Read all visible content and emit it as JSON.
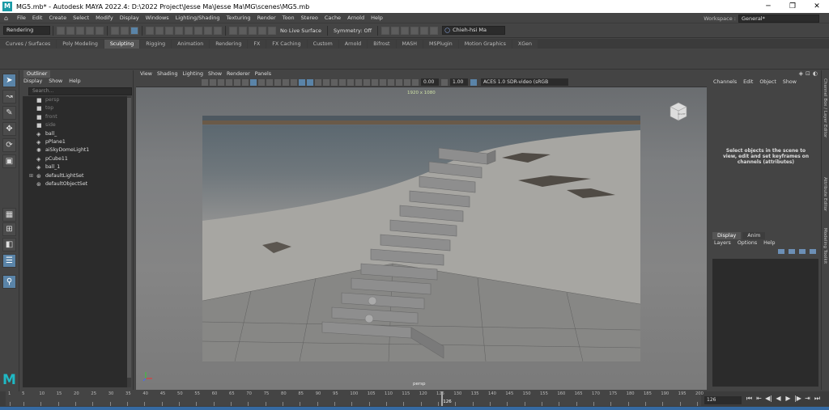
{
  "window": {
    "title": "MG5.mb* - Autodesk MAYA 2022.4: D:\\2022 Project\\Jesse Ma\\Jesse Ma\\MG\\scenes\\MG5.mb",
    "app_icon": "M",
    "minimize": "─",
    "maximize": "❐",
    "close": "✕"
  },
  "menu": {
    "items": [
      "File",
      "Edit",
      "Create",
      "Select",
      "Modify",
      "Display",
      "Windows",
      "Lighting/Shading",
      "Texturing",
      "Render",
      "Toon",
      "Stereo",
      "Cache",
      "Arnold",
      "Help"
    ],
    "workspace_label": "Workspace :",
    "workspace_value": "General*"
  },
  "status_line": {
    "mode": "Rendering",
    "live_surface": "No Live Surface",
    "symmetry": "Symmetry: Off",
    "user": "Chieh-hsi Ma"
  },
  "shelf": {
    "tabs": [
      "Curves / Surfaces",
      "Poly Modeling",
      "Sculpting",
      "Rigging",
      "Animation",
      "Rendering",
      "FX",
      "FX Caching",
      "Custom",
      "Arnold",
      "Bifrost",
      "MASH",
      "MSPlugin",
      "Motion Graphics",
      "XGen"
    ],
    "active_tab": "Sculpting"
  },
  "toolbox": {
    "tools": [
      {
        "name": "select-tool-icon",
        "glyph": "➤",
        "on": true
      },
      {
        "name": "lasso-tool-icon",
        "glyph": "↝",
        "on": false
      },
      {
        "name": "paint-select-tool-icon",
        "glyph": "✎",
        "on": false
      },
      {
        "name": "move-tool-icon",
        "glyph": "✥",
        "on": false
      },
      {
        "name": "rotate-tool-icon",
        "glyph": "⟳",
        "on": false
      },
      {
        "name": "scale-tool-icon",
        "glyph": "▣",
        "on": false
      },
      {
        "name": "single-perspective-icon",
        "glyph": "▦",
        "on": false
      },
      {
        "name": "four-view-icon",
        "glyph": "⊞",
        "on": false
      },
      {
        "name": "two-view-icon",
        "glyph": "◧",
        "on": false
      },
      {
        "name": "outliner-layout-icon",
        "glyph": "☰",
        "on": true
      },
      {
        "name": "search-tool-icon",
        "glyph": "⚲",
        "on": true
      }
    ],
    "logo": "M"
  },
  "outliner": {
    "tab": "Outliner",
    "menu": [
      "Display",
      "Show",
      "Help"
    ],
    "search_placeholder": "Search...",
    "items": [
      {
        "label": "persp",
        "icon": "camera-icon",
        "glyph": "■",
        "dim": true,
        "expand": ""
      },
      {
        "label": "top",
        "icon": "camera-icon",
        "glyph": "■",
        "dim": true,
        "expand": ""
      },
      {
        "label": "front",
        "icon": "camera-icon",
        "glyph": "■",
        "dim": true,
        "expand": ""
      },
      {
        "label": "side",
        "icon": "camera-icon",
        "glyph": "■",
        "dim": true,
        "expand": ""
      },
      {
        "label": "ball_",
        "icon": "mesh-icon",
        "glyph": "◈",
        "dim": false,
        "expand": ""
      },
      {
        "label": "pPlane1",
        "icon": "mesh-icon",
        "glyph": "◈",
        "dim": false,
        "expand": ""
      },
      {
        "label": "aiSkyDomeLight1",
        "icon": "light-icon",
        "glyph": "✺",
        "dim": false,
        "expand": ""
      },
      {
        "label": "pCube11",
        "icon": "mesh-icon",
        "glyph": "◈",
        "dim": false,
        "expand": ""
      },
      {
        "label": "ball_1",
        "icon": "mesh-icon",
        "glyph": "◈",
        "dim": false,
        "expand": ""
      },
      {
        "label": "defaultLightSet",
        "icon": "set-icon",
        "glyph": "⊛",
        "dim": false,
        "expand": "⊞"
      },
      {
        "label": "defaultObjectSet",
        "icon": "set-icon",
        "glyph": "⊛",
        "dim": false,
        "expand": ""
      }
    ]
  },
  "viewport": {
    "menu": [
      "View",
      "Shading",
      "Lighting",
      "Show",
      "Renderer",
      "Panels"
    ],
    "exposure": "0.00",
    "gamma": "1.00",
    "color_space": "ACES 1.0 SDR-video (sRGB",
    "resolution_gate": "1920 x 1080",
    "camera": "persp",
    "viewcube_label": "RIGHT"
  },
  "channel_box": {
    "menu": [
      "Channels",
      "Edit",
      "Object",
      "Show"
    ],
    "message": "Select objects in the scene to view, edit and set keyframes on channels (attributes)",
    "layer_tabs": [
      "Display",
      "Anim"
    ],
    "layer_menu": [
      "Layers",
      "Options",
      "Help"
    ],
    "side_tabs": [
      "Channel Box / Layer Editor",
      "Attribute Editor",
      "Modeling Toolkit"
    ]
  },
  "timeline": {
    "ticks": [
      "1",
      "5",
      "10",
      "15",
      "20",
      "25",
      "30",
      "35",
      "40",
      "45",
      "50",
      "55",
      "60",
      "65",
      "70",
      "75",
      "80",
      "85",
      "90",
      "95",
      "100",
      "105",
      "110",
      "115",
      "120",
      "125",
      "130",
      "135",
      "140",
      "145",
      "150",
      "155",
      "160",
      "165",
      "170",
      "175",
      "180",
      "185",
      "190",
      "195",
      "200"
    ],
    "range_start": 1,
    "range_end": 200,
    "current_frame": 126,
    "current_frame_label": "126",
    "frame_field": "126",
    "playback": [
      "⏮",
      "⇤",
      "◀|",
      "◀",
      "▶",
      "|▶",
      "⇥",
      "⏭"
    ]
  }
}
